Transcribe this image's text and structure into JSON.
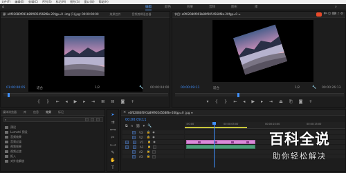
{
  "menubar": [
    "文件(F)",
    "编辑(E)",
    "剪辑(C)",
    "序列(S)",
    "标记(M)",
    "图形(G)",
    "窗口(W)",
    "帮助(H)"
  ],
  "workspaces": [
    {
      "label": "编辑",
      "active": true
    },
    {
      "label": "颜色",
      "active": false
    },
    {
      "label": "效果",
      "active": false
    },
    {
      "label": "音频",
      "active": false
    },
    {
      "label": "图形",
      "active": false
    },
    {
      "label": "库",
      "active": false
    }
  ],
  "source": {
    "tabs": [
      "源: e0f02080f091b89f9054568f8e-20fgp=0 .img (1).jpg: 00:00:00:00",
      "效果控件",
      "音频剪辑混合器"
    ],
    "timecode": "01:00:00:05",
    "fit": "适合",
    "fraction": "1/2",
    "duration": "00:00:04:00"
  },
  "program": {
    "tab": "节目: e0f02080f091b89f9054568f8e-20fgp=0 ≡",
    "timecode": "00:00:09:11",
    "fit": "适合",
    "fraction": "1/2",
    "duration": "00:00:26:13"
  },
  "project": {
    "tabs": [
      "媒体浏览器",
      "库",
      "信息",
      "效果",
      "标记"
    ],
    "items": [
      "预设",
      "Lumetri 预设",
      "音频效果",
      "音频过渡",
      "视频效果",
      "视频过渡",
      "抠入",
      "对外化解放"
    ]
  },
  "timeline": {
    "tab": "e0f02080f091b89f9054568f8e-20fgp=0 .jpg ≡",
    "timecode": "00:00:09:11",
    "ruler": [
      ":00:00",
      "00:00:05:00",
      "00:00:10:00",
      "00:00:15:00"
    ],
    "tracks": [
      "V3",
      "V2",
      "V1",
      "A1",
      "A2",
      "A3"
    ]
  },
  "watermark": {
    "main": "百科全说",
    "sub": "助你轻松解决"
  },
  "colors": {
    "accent": "#3f8fff",
    "clip_pink": "#d98ad8",
    "clip_green": "#4fa07a",
    "playhead": "#3f8fff",
    "yellow_bar": "#c8c63a"
  }
}
